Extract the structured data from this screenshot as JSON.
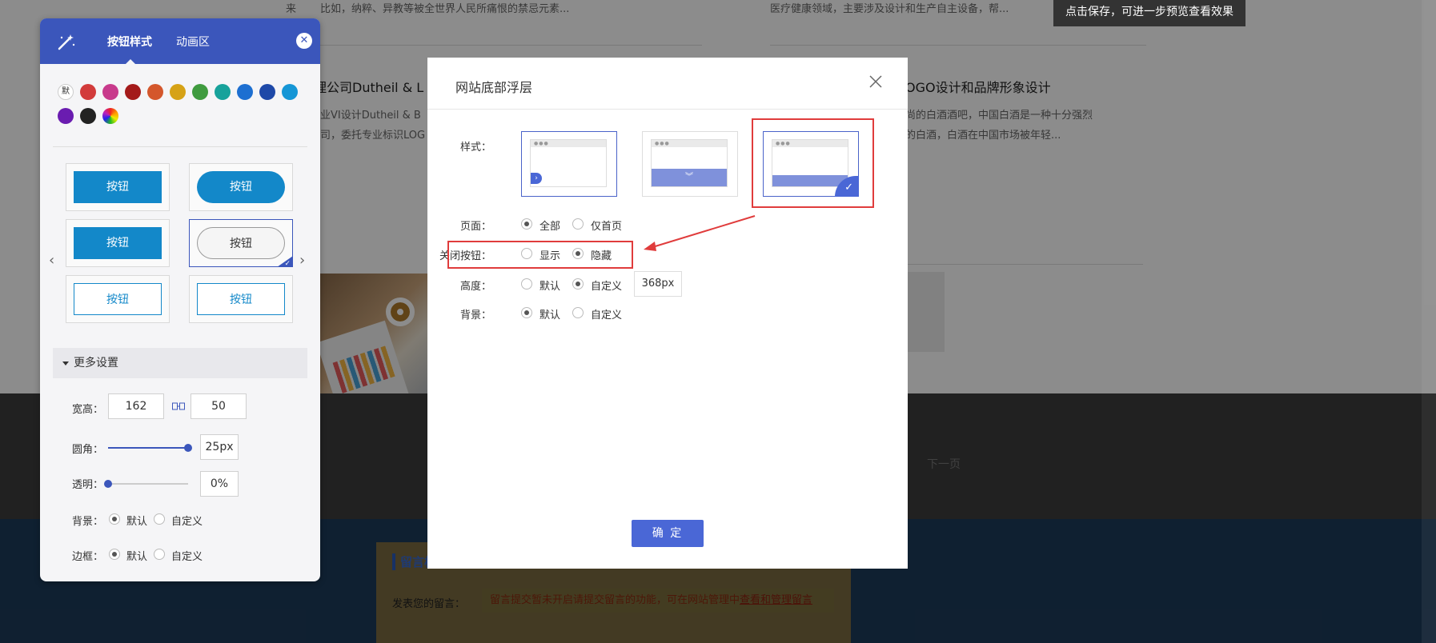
{
  "background": {
    "texts": [
      {
        "id": "bg-lai",
        "text": "来"
      },
      {
        "id": "bg-desc-1",
        "text": "比如，纳粹、异教等被全世界人民所痛恨的禁忌元素..."
      },
      {
        "id": "bg-desc-2",
        "text": "医疗健康领域，主要涉及设计和生产自主设备，帮..."
      },
      {
        "id": "bg-title-1",
        "text": "理公司Dutheil & L"
      },
      {
        "id": "bg-title-2",
        "text": "OGO设计和品牌形象设计"
      },
      {
        "id": "bg-desc-3",
        "text": "业VI设计Dutheil & B"
      },
      {
        "id": "bg-desc-4",
        "text": "尚的白酒酒吧，中国白酒是一种十分强烈"
      },
      {
        "id": "bg-desc-5",
        "text": "司，委托专业标识LOG"
      },
      {
        "id": "bg-desc-6",
        "text": "的白酒，白酒在中国市场被年轻..."
      }
    ],
    "save_tip": "点击保存，可进一步预览查看效果",
    "next_page": "下一页",
    "message": {
      "title": "留言板",
      "label": "发表您的留言：",
      "warning": "留言提交暂未开启请提交留言的功能，可在网站管理中",
      "warning_link": "查看和管理留言"
    }
  },
  "panel": {
    "tabs": [
      {
        "label": "按钮样式"
      },
      {
        "label": "动画区"
      }
    ],
    "default_swatch": "默",
    "swatch_colors": [
      "#d23b3b",
      "#c83a8c",
      "#a41a1a",
      "#d4572c",
      "#d6a216",
      "#3f9b3f",
      "#17a29b",
      "#1d6fd1",
      "#1e49a8",
      "#1596d6",
      "#6a1cb0",
      "#222222"
    ],
    "buttons": [
      {
        "label": "按钮"
      },
      {
        "label": "按钮"
      },
      {
        "label": "按钮"
      },
      {
        "label": "按钮"
      },
      {
        "label": "按钮"
      },
      {
        "label": "按钮"
      }
    ],
    "more_settings": "更多设置",
    "size": {
      "label": "宽高：",
      "width": "162",
      "height": "50"
    },
    "radius": {
      "label": "圆角：",
      "value": "25px",
      "level": 1.0
    },
    "opacity": {
      "label": "透明：",
      "value": "0%",
      "level": 0.0
    },
    "background": {
      "label": "背景：",
      "options": [
        "默认",
        "自定义"
      ],
      "selected": 0
    },
    "border": {
      "label": "边框：",
      "options": [
        "默认",
        "自定义"
      ],
      "selected": 0
    }
  },
  "modal": {
    "title": "网站底部浮层",
    "style_label": "样式：",
    "page": {
      "label": "页面：",
      "options": [
        "全部",
        "仅首页"
      ],
      "selected": 0
    },
    "close_button": {
      "label": "关闭按钮：",
      "options": [
        "显示",
        "隐藏"
      ],
      "selected": 1
    },
    "height": {
      "label": "高度：",
      "options": [
        "默认",
        "自定义"
      ],
      "selected": 1,
      "value": "368px"
    },
    "background": {
      "label": "背景：",
      "options": [
        "默认",
        "自定义"
      ],
      "selected": 0
    },
    "confirm": "确 定"
  },
  "colors": {
    "panel_header": "#3b56bb",
    "button_fill": "#1388c9",
    "modal_accent": "#4a67d6",
    "highlight": "#e03c3c"
  }
}
